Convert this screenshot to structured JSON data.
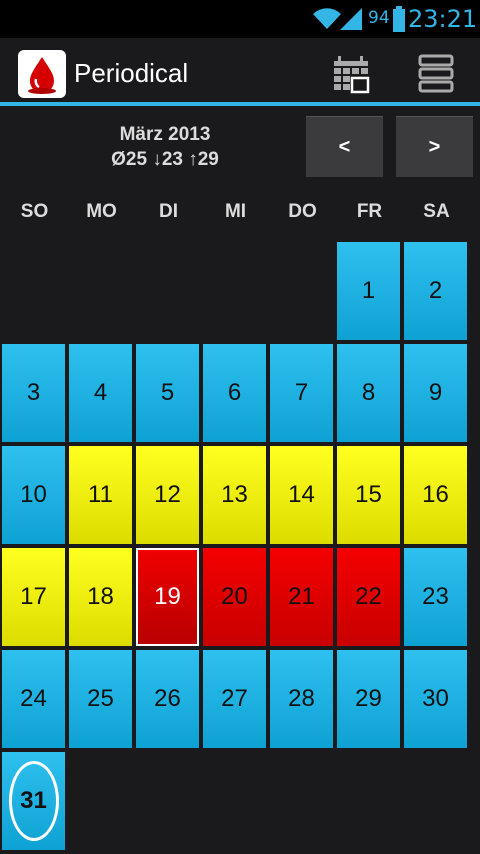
{
  "status_bar": {
    "battery_percent": "94",
    "time": "23:21",
    "accent_color": "#33b5e5"
  },
  "action_bar": {
    "title": "Periodical",
    "app_icon": "blood-drop-icon",
    "calendar_icon": "calendar-grid-icon",
    "list_icon": "list-stack-icon"
  },
  "month_header": {
    "month": "März 2013",
    "stats": "Ø25 ↓23 ↑29",
    "prev_label": "<",
    "next_label": ">"
  },
  "weekdays": [
    "SO",
    "MO",
    "DI",
    "MI",
    "DO",
    "FR",
    "SA"
  ],
  "colors": {
    "normal": "#1ab0e0",
    "fertile": "#f0f000",
    "period": "#e00000"
  },
  "days": [
    {
      "day": "1",
      "type": "normal"
    },
    {
      "day": "2",
      "type": "normal"
    },
    {
      "day": "3",
      "type": "normal"
    },
    {
      "day": "4",
      "type": "normal"
    },
    {
      "day": "5",
      "type": "normal"
    },
    {
      "day": "6",
      "type": "normal"
    },
    {
      "day": "7",
      "type": "normal"
    },
    {
      "day": "8",
      "type": "normal"
    },
    {
      "day": "9",
      "type": "normal"
    },
    {
      "day": "10",
      "type": "normal"
    },
    {
      "day": "11",
      "type": "fertile"
    },
    {
      "day": "12",
      "type": "fertile"
    },
    {
      "day": "13",
      "type": "fertile"
    },
    {
      "day": "14",
      "type": "fertile"
    },
    {
      "day": "15",
      "type": "fertile"
    },
    {
      "day": "16",
      "type": "fertile"
    },
    {
      "day": "17",
      "type": "fertile"
    },
    {
      "day": "18",
      "type": "fertile"
    },
    {
      "day": "19",
      "type": "period",
      "selected": true
    },
    {
      "day": "20",
      "type": "period"
    },
    {
      "day": "21",
      "type": "period"
    },
    {
      "day": "22",
      "type": "period"
    },
    {
      "day": "23",
      "type": "normal"
    },
    {
      "day": "24",
      "type": "normal"
    },
    {
      "day": "25",
      "type": "normal"
    },
    {
      "day": "26",
      "type": "normal"
    },
    {
      "day": "27",
      "type": "normal"
    },
    {
      "day": "28",
      "type": "normal"
    },
    {
      "day": "29",
      "type": "normal"
    },
    {
      "day": "30",
      "type": "normal"
    },
    {
      "day": "31",
      "type": "normal",
      "today": true
    }
  ]
}
